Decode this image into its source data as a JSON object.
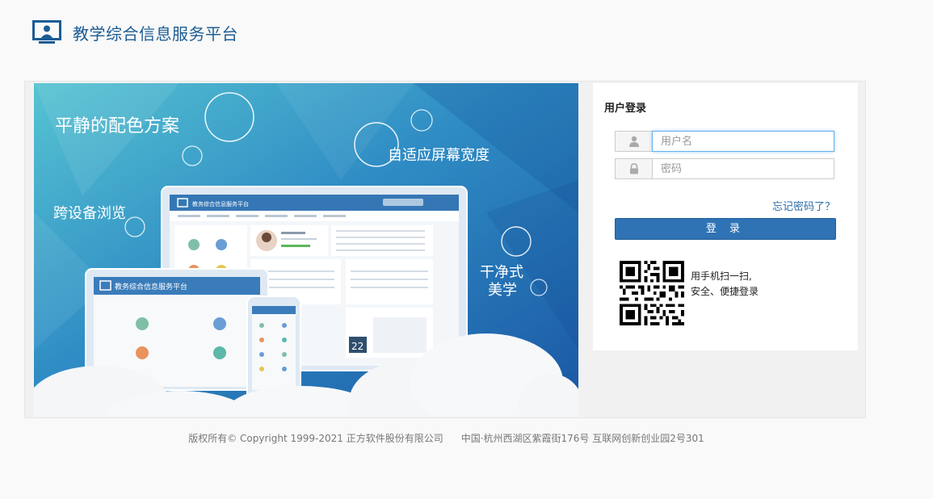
{
  "header": {
    "title": "教学综合信息服务平台",
    "logo_icon": "monitor-user-icon"
  },
  "banner": {
    "slogans": {
      "palette": "平静的配色方案",
      "adaptive": "自适应屏幕宽度",
      "cross_device": "跨设备浏览",
      "clean_line1": "干净式",
      "clean_line2": "美学"
    },
    "mock_app_title": "教务综合信息服务平台",
    "mock_tablet_title": "教务综合信息服务平台",
    "mock_calendar_day": "22",
    "colors": {
      "top": "#49b8cf",
      "bottom": "#1c5da7"
    }
  },
  "login": {
    "title": "用户登录",
    "username_placeholder": "用户名",
    "password_placeholder": "密码",
    "forgot_label": "忘记密码了？",
    "submit_label": "登 录",
    "qr_line1": "用手机扫一扫,",
    "qr_line2": "安全、便捷登录",
    "user_icon": "user-icon",
    "lock_icon": "lock-icon",
    "accent": "#2f73b5"
  },
  "footer": {
    "copyright": "版权所有© Copyright 1999-2021 正方软件股份有限公司",
    "address": "中国·杭州西湖区紫霞街176号 互联网创新创业园2号301"
  }
}
